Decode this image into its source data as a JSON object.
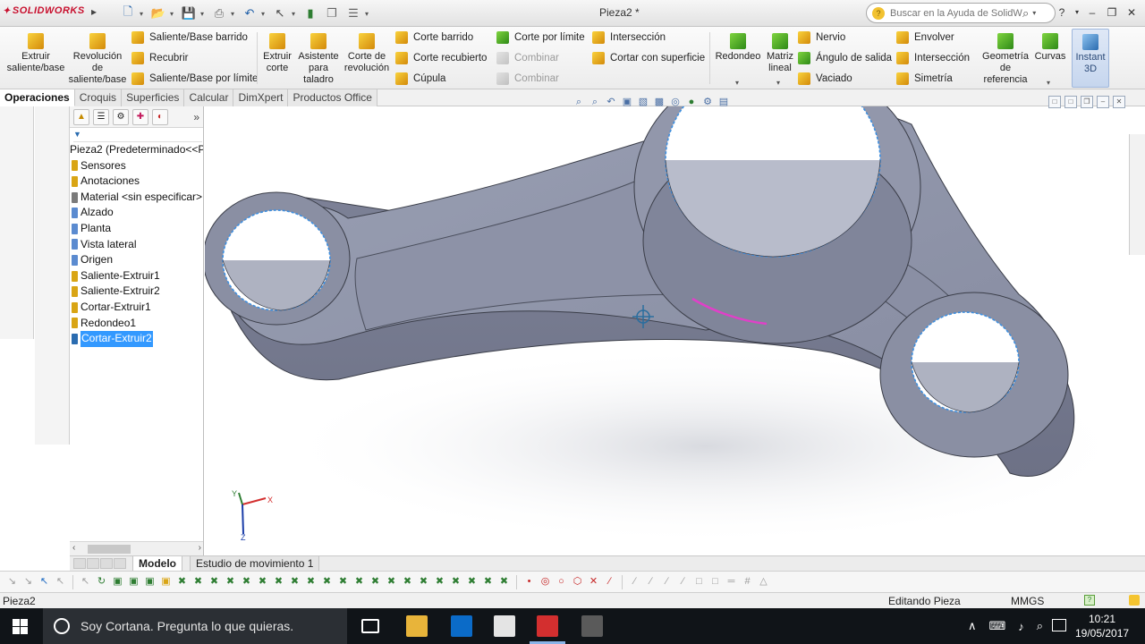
{
  "app": {
    "logo_text": "SOLIDWORKS",
    "doc_title": "Pieza2 *",
    "search_placeholder": "Buscar en la Ayuda de SolidWorks"
  },
  "ribbon": {
    "extruir_saliente": "Extruir saliente/base",
    "revolucion_saliente": "Revolución de saliente/base",
    "saliente_barrido": "Saliente/Base barrido",
    "recubrir": "Recubrir",
    "saliente_limite": "Saliente/Base por límite",
    "extruir_corte": "Extruir corte",
    "asistente_taladro": "Asistente para taladro",
    "corte_revolucion": "Corte de revolución",
    "corte_barrido": "Corte barrido",
    "corte_recubierto": "Corte recubierto",
    "cupula": "Cúpula",
    "corte_limite": "Corte por límite",
    "combinar_1": "Combinar",
    "combinar_2": "Combinar",
    "interseccion_1": "Intersección",
    "cortar_superficie": "Cortar con superficie",
    "redondeo": "Redondeo",
    "matriz_lineal": "Matriz lineal",
    "nervio": "Nervio",
    "angulo_salida": "Ángulo de salida",
    "vaciado": "Vaciado",
    "envolver": "Envolver",
    "interseccion_2": "Intersección",
    "simetria": "Simetría",
    "geometria_referencia": "Geometría de referencia",
    "curvas": "Curvas",
    "instant3d": "Instant 3D"
  },
  "command_tabs": [
    "Operaciones",
    "Croquis",
    "Superficies",
    "Calcular",
    "DimXpert",
    "Productos Office"
  ],
  "feature_tree": {
    "root": "Pieza2  (Predeterminado<<Pr",
    "items": [
      "Sensores",
      "Anotaciones",
      "Material <sin especificar>",
      "Alzado",
      "Planta",
      "Vista lateral",
      "Origen",
      "Saliente-Extruir1",
      "Saliente-Extruir2",
      "Cortar-Extruir1",
      "Redondeo1",
      "Cortar-Extruir2"
    ],
    "selected_index": 11
  },
  "bottom_tabs": [
    "Modelo",
    "Estudio de movimiento 1"
  ],
  "status": {
    "left": "Pieza2",
    "mode": "Editando Pieza",
    "units": "MMGS"
  },
  "taskbar": {
    "cortana_text": "Soy Cortana. Pregunta lo que quieras.",
    "time": "10:21",
    "date": "19/05/2017"
  },
  "triad": {
    "x_label": "X",
    "y_label": "Y",
    "z_label": "Z"
  },
  "colors": {
    "model_fill": "#8e93a8",
    "edge_highlight": "#3d8fe0",
    "selection_magenta": "#e040c8",
    "accent_red": "#c8102e"
  }
}
